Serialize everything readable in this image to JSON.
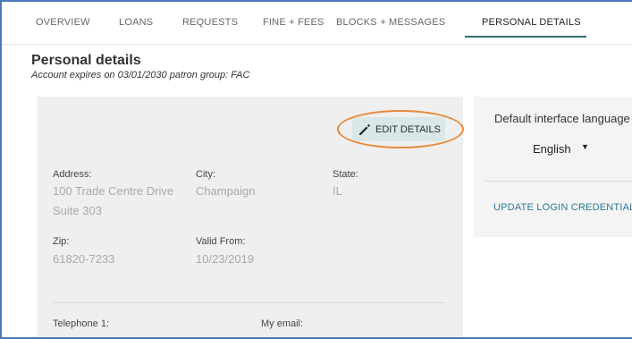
{
  "tabs": [
    {
      "label": "OVERVIEW"
    },
    {
      "label": "LOANS"
    },
    {
      "label": "REQUESTS"
    },
    {
      "label": "FINE + FEES"
    },
    {
      "label": "BLOCKS + MESSAGES"
    },
    {
      "label": "PERSONAL DETAILS",
      "active": true
    }
  ],
  "page": {
    "title": "Personal details",
    "subtitle": "Account expires on 03/01/2030 patron group: FAC"
  },
  "details": {
    "edit_label": "EDIT DETAILS",
    "address_label": "Address:",
    "address_line1": "100 Trade Centre Drive",
    "address_line2": "Suite 303",
    "city_label": "City:",
    "city_value": "Champaign",
    "state_label": "State:",
    "state_value": "IL",
    "zip_label": "Zip:",
    "zip_value": "61820-7233",
    "valid_from_label": "Valid From:",
    "valid_from_value": "10/23/2019",
    "telephone_label": "Telephone 1:",
    "email_label": "My email:"
  },
  "side": {
    "heading": "Default interface language",
    "language": "English",
    "update_link": "UPDATE LOGIN CREDENTIALS"
  },
  "colors": {
    "accent": "#2f6f6f",
    "link": "#2b7a96",
    "highlight_ring": "#e88a3a",
    "frame_border": "#4a78b8"
  }
}
